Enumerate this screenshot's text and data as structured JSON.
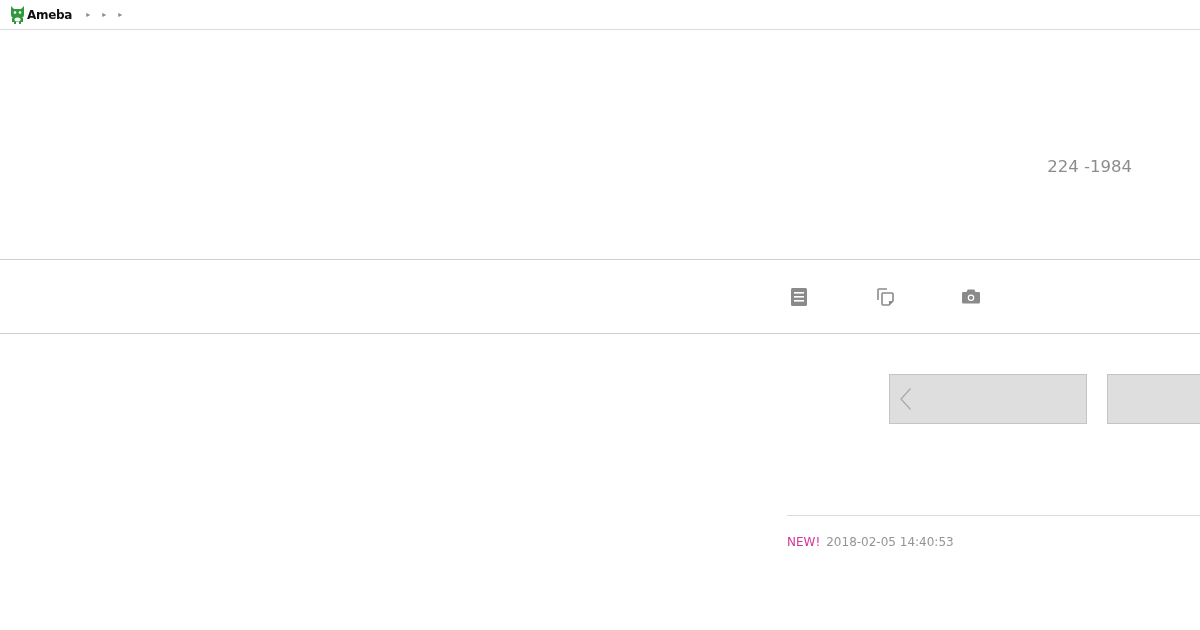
{
  "header": {
    "logo": "Ameba",
    "breadcrumb": [
      "▸",
      "▸",
      "▸"
    ]
  },
  "profile": {
    "text": "224 -1984"
  },
  "nav": [
    {
      "kind": "entries"
    },
    {
      "kind": "pages"
    },
    {
      "kind": "photos"
    }
  ],
  "pager": [
    {
      "kind": "prev"
    },
    {
      "kind": "next"
    }
  ],
  "latest": {
    "badge": "NEW!",
    "date": "2018-02-05 14:40:53"
  }
}
